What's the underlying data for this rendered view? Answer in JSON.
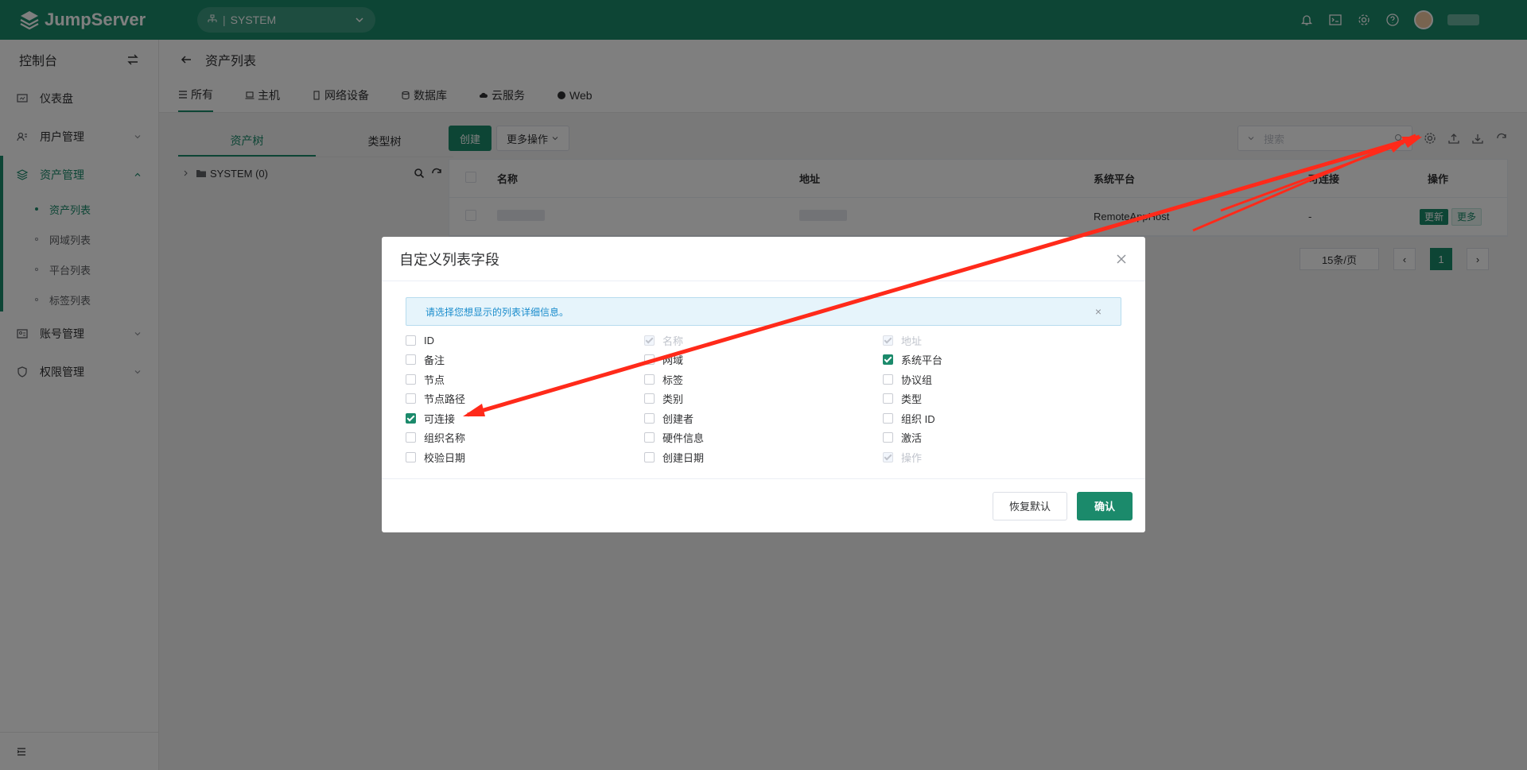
{
  "app": {
    "brand": "JumpServer",
    "org": "SYSTEM"
  },
  "sidebar": {
    "title": "控制台",
    "items": [
      {
        "label": "仪表盘"
      },
      {
        "label": "用户管理"
      },
      {
        "label": "资产管理"
      },
      {
        "label": "账号管理"
      },
      {
        "label": "权限管理"
      }
    ],
    "sub": [
      "资产列表",
      "网域列表",
      "平台列表",
      "标签列表"
    ]
  },
  "page": {
    "title": "资产列表",
    "tabs": [
      "所有",
      "主机",
      "网络设备",
      "数据库",
      "云服务",
      "Web"
    ]
  },
  "tree": {
    "tabs": [
      "资产树",
      "类型树"
    ],
    "node": "SYSTEM (0)"
  },
  "toolbar": {
    "create": "创建",
    "more": "更多操作",
    "search_placeholder": "搜索"
  },
  "table": {
    "headers": [
      "名称",
      "地址",
      "系统平台",
      "可连接",
      "操作"
    ],
    "row": {
      "platform": "RemoteAppHost",
      "connect": "-",
      "update": "更新",
      "more": "更多"
    }
  },
  "pager": {
    "size": "15条/页",
    "page": "1"
  },
  "modal": {
    "title": "自定义列表字段",
    "hint": "请选择您想显示的列表详细信息。",
    "fields": [
      {
        "label": "ID",
        "state": "off"
      },
      {
        "label": "名称",
        "state": "disabled"
      },
      {
        "label": "地址",
        "state": "disabled"
      },
      {
        "label": "备注",
        "state": "off"
      },
      {
        "label": "网域",
        "state": "off"
      },
      {
        "label": "系统平台",
        "state": "on"
      },
      {
        "label": "节点",
        "state": "off"
      },
      {
        "label": "标签",
        "state": "off"
      },
      {
        "label": "协议组",
        "state": "off"
      },
      {
        "label": "节点路径",
        "state": "off"
      },
      {
        "label": "类别",
        "state": "off"
      },
      {
        "label": "类型",
        "state": "off"
      },
      {
        "label": "可连接",
        "state": "on"
      },
      {
        "label": "创建者",
        "state": "off"
      },
      {
        "label": "组织 ID",
        "state": "off"
      },
      {
        "label": "组织名称",
        "state": "off"
      },
      {
        "label": "硬件信息",
        "state": "off"
      },
      {
        "label": "激活",
        "state": "off"
      },
      {
        "label": "校验日期",
        "state": "off"
      },
      {
        "label": "创建日期",
        "state": "off"
      },
      {
        "label": "操作",
        "state": "disabled"
      }
    ],
    "reset": "恢复默认",
    "confirm": "确认"
  }
}
